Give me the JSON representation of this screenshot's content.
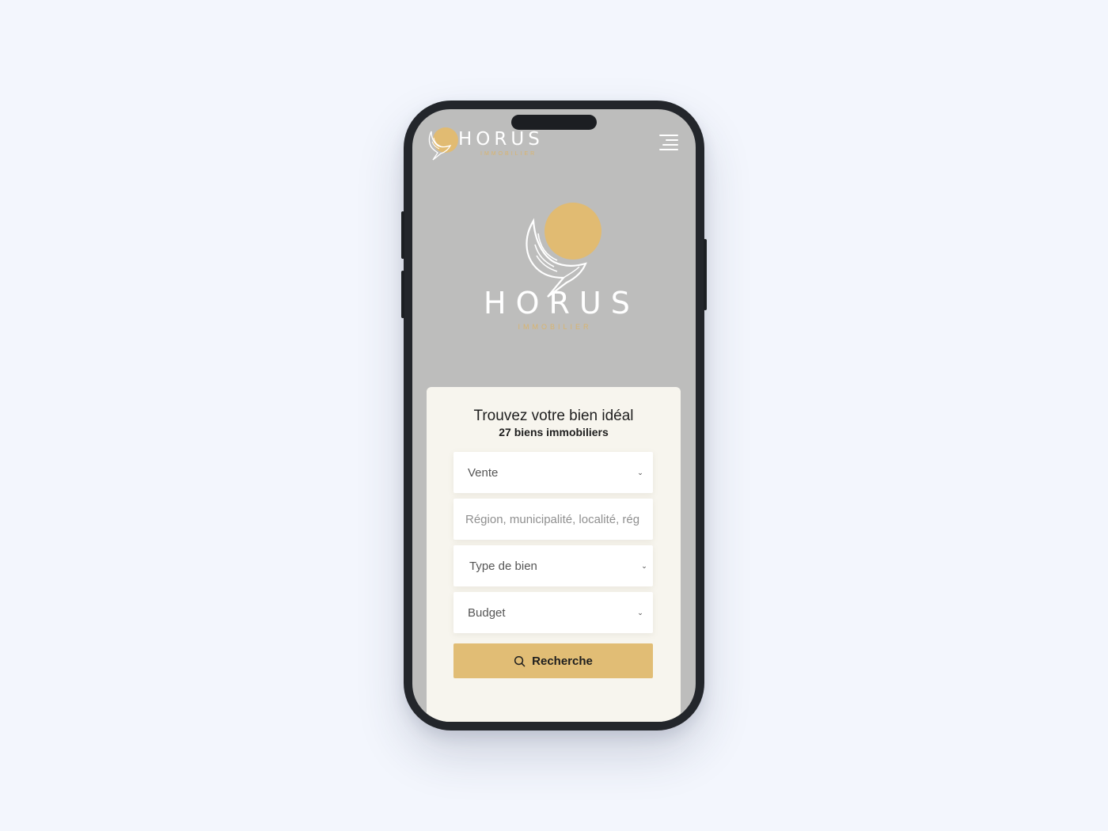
{
  "brand": {
    "name": "HORUS",
    "tagline": "IMMOBILIER",
    "accent_color": "#e1bb72"
  },
  "header": {
    "menu_icon": "hamburger-menu-icon"
  },
  "search": {
    "title": "Trouvez votre bien idéal",
    "subtitle": "27 biens immobiliers",
    "transaction_value": "Vente",
    "location_placeholder": "Région, municipalité, localité, rég",
    "property_type_value": "Type de bien",
    "budget_value": "Budget",
    "submit_label": "Recherche",
    "submit_icon": "search-icon"
  }
}
